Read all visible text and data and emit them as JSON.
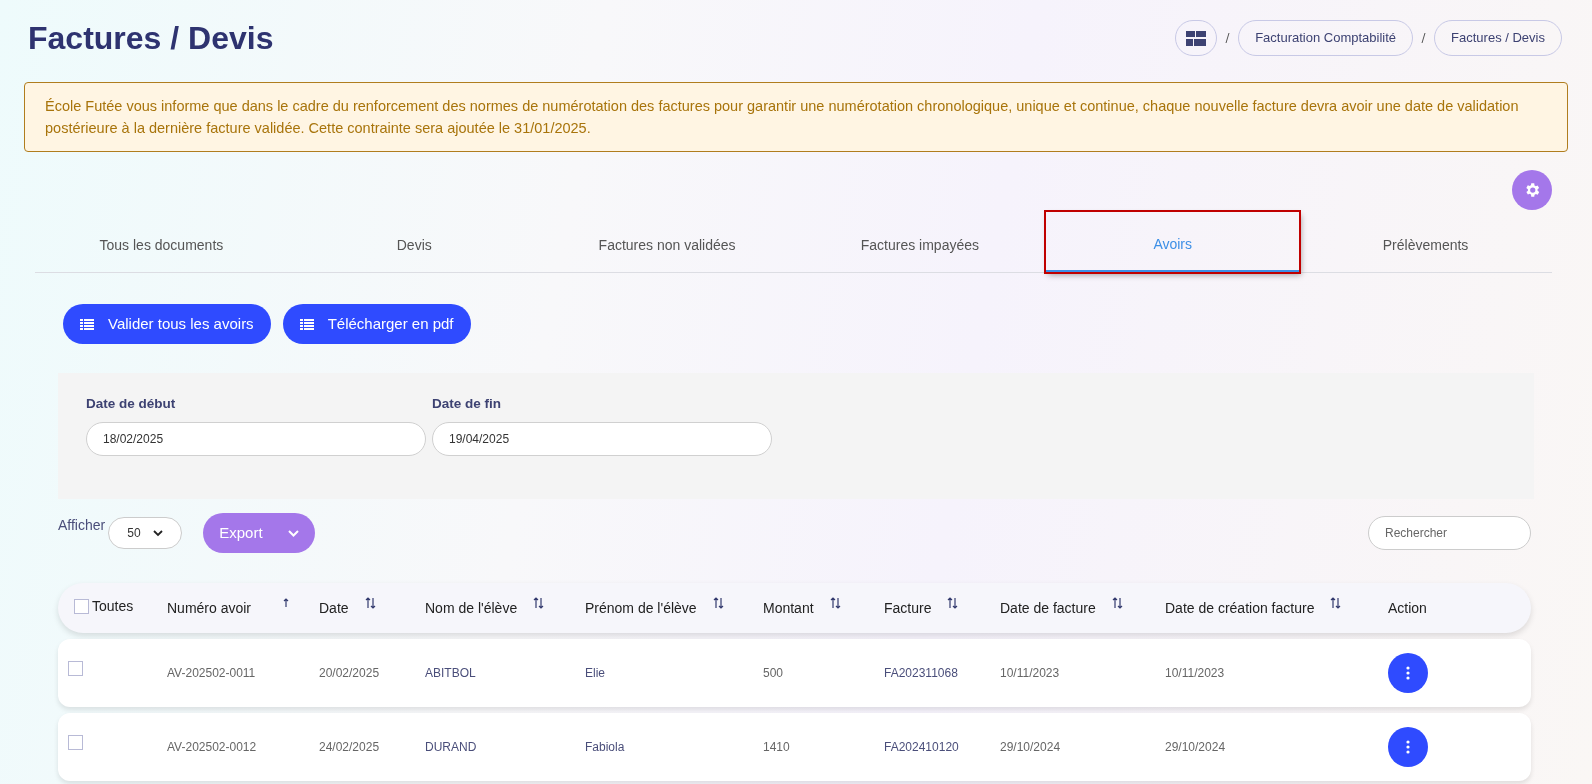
{
  "page_title": "Factures / Devis",
  "breadcrumb": [
    "Facturation Comptabilité",
    "Factures / Devis"
  ],
  "notice": "École Futée vous informe que dans le cadre du renforcement des normes de numérotation des factures pour garantir une numérotation chronologique, unique et continue, chaque nouvelle facture devra avoir une date de validation postérieure à la dernière facture validée. Cette contrainte sera ajoutée le 31/01/2025.",
  "tabs": [
    {
      "label": "Tous les documents",
      "selected": false,
      "highlighted": false
    },
    {
      "label": "Devis",
      "selected": false,
      "highlighted": false
    },
    {
      "label": "Factures non validées",
      "selected": false,
      "highlighted": false
    },
    {
      "label": "Factures impayées",
      "selected": false,
      "highlighted": false
    },
    {
      "label": "Avoirs",
      "selected": true,
      "highlighted": true
    },
    {
      "label": "Prélèvements",
      "selected": false,
      "highlighted": false
    }
  ],
  "actions": [
    "Valider tous les avoirs",
    "Télécharger en pdf"
  ],
  "filters": [
    {
      "label": "Date de début",
      "value": "18/02/2025"
    },
    {
      "label": "Date de fin",
      "value": "19/04/2025"
    }
  ],
  "show_label": "Afficher",
  "page_size": "50",
  "export_label": "Export",
  "search": {
    "placeholder": "Rechercher"
  },
  "table": {
    "select_all": {
      "label": "Toutes",
      "checked": false
    },
    "columns": [
      {
        "label": "Numéro avoir",
        "sortable": true,
        "sorted": true
      },
      {
        "label": "Date",
        "sortable": true,
        "sorted": false
      },
      {
        "label": "Nom de l'élève",
        "sortable": true,
        "sorted": false
      },
      {
        "label": "Prénom de l'élève",
        "sortable": true,
        "sorted": false
      },
      {
        "label": "Montant",
        "sortable": true,
        "sorted": false
      },
      {
        "label": "Facture",
        "sortable": true,
        "sorted": false
      },
      {
        "label": "Date de facture",
        "sortable": true,
        "sorted": false
      },
      {
        "label": "Date de création facture",
        "sortable": true,
        "sorted": false
      },
      {
        "label": "Action"
      }
    ],
    "rows": [
      {
        "checked": false,
        "cells": [
          "AV-202502-0011",
          "20/02/2025",
          "ABITBOL",
          "Elie",
          "500",
          "FA202311068",
          "10/11/2023",
          "10/11/2023"
        ]
      },
      {
        "checked": false,
        "cells": [
          "AV-202502-0012",
          "24/02/2025",
          "DURAND",
          "Fabiola",
          "1410",
          "FA202410120",
          "29/10/2024",
          "29/10/2024"
        ]
      }
    ]
  }
}
